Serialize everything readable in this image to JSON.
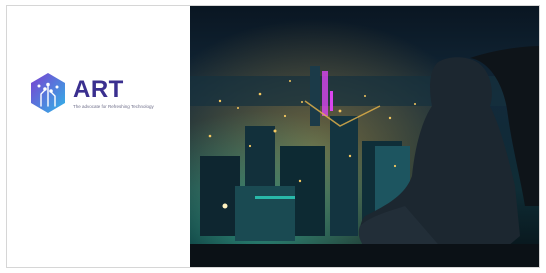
{
  "logo": {
    "name": "ART",
    "tagline": "The advocate for Refreshing Technology",
    "icon": "circuit-hexagon-icon",
    "colors": {
      "primary": "#3a2f8f",
      "gradient_start": "#7b3fd0",
      "gradient_end": "#2fb6e8"
    }
  },
  "photo": {
    "icon": "night-city-woman-photo",
    "colors": {
      "sky": "#0d1b2a",
      "city_lights": "#e8b54a",
      "neon": "#d946ef",
      "teal": "#2dd4bf"
    }
  }
}
